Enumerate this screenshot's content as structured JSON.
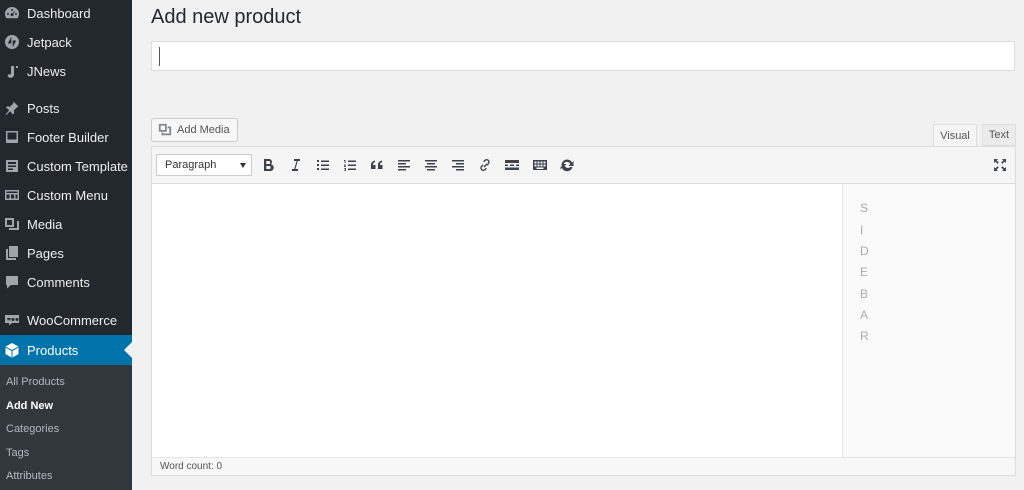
{
  "sidebar": {
    "items": [
      {
        "label": "Dashboard",
        "icon": "dashboard-icon"
      },
      {
        "label": "Jetpack",
        "icon": "jetpack-icon"
      },
      {
        "label": "JNews",
        "icon": "jnews-icon"
      },
      {
        "label": "Posts",
        "icon": "pin-icon"
      },
      {
        "label": "Footer Builder",
        "icon": "footer-builder-icon"
      },
      {
        "label": "Custom Template",
        "icon": "custom-template-icon"
      },
      {
        "label": "Custom Menu",
        "icon": "custom-menu-icon"
      },
      {
        "label": "Media",
        "icon": "media-icon"
      },
      {
        "label": "Pages",
        "icon": "pages-icon"
      },
      {
        "label": "Comments",
        "icon": "comments-icon"
      },
      {
        "label": "WooCommerce",
        "icon": "woocommerce-icon"
      },
      {
        "label": "Products",
        "icon": "products-box-icon",
        "active": true
      }
    ],
    "submenu": [
      {
        "label": "All Products"
      },
      {
        "label": "Add New",
        "current": true
      },
      {
        "label": "Categories"
      },
      {
        "label": "Tags"
      },
      {
        "label": "Attributes"
      }
    ],
    "colors": {
      "background": "#23282d",
      "active": "#0073aa",
      "submenu": "#32373c"
    }
  },
  "main": {
    "page_title": "Add new product",
    "title_input": {
      "value": ""
    },
    "add_media_label": "Add Media",
    "tabs": {
      "visual": "Visual",
      "text": "Text",
      "selected": "Visual"
    },
    "toolbar": {
      "format_value": "Paragraph",
      "buttons": [
        "bold-icon",
        "italic-icon",
        "bullet-list-icon",
        "numbered-list-icon",
        "blockquote-icon",
        "align-left-icon",
        "align-center-icon",
        "align-right-icon",
        "link-icon",
        "read-more-icon",
        "toolbar-toggle-icon",
        "refresh-icon"
      ],
      "fullscreen_icon": "fullscreen-icon"
    },
    "sidebar_preview": {
      "letters": [
        "S",
        "I",
        "D",
        "E",
        "B",
        "A",
        "R"
      ]
    },
    "word_count": "Word count: 0"
  }
}
